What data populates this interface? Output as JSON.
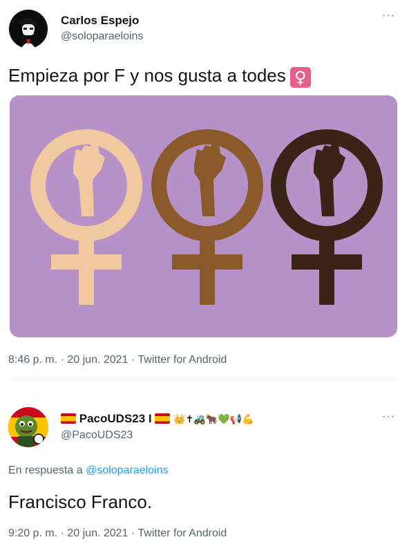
{
  "tweet1": {
    "display_name": "Carlos Espejo",
    "handle": "@soloparaeloins",
    "more_label": "···",
    "text": "Empieza por F y nos gusta a todes",
    "text_emoji": "♀",
    "timestamp": "8:46 p. m. · 20 jun. 2021 · Twitter for Android",
    "image_colors": {
      "background": "#b792c8",
      "symbol_light": "#f1c9a0",
      "symbol_medium": "#8b5a2b",
      "symbol_dark": "#3a2418"
    }
  },
  "tweet2": {
    "display_name": "PacoUDS23 I",
    "name_emojis": "👑✝🚜🐂💚📢💪",
    "handle": "@PacoUDS23",
    "more_label": "···",
    "reply_prefix": "En respuesta a",
    "reply_to": "@soloparaeloins",
    "text": "Francisco Franco.",
    "timestamp": "9:20 p. m. · 20 jun. 2021 · Twitter for Android"
  }
}
